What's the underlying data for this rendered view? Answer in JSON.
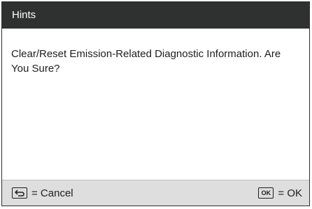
{
  "dialog": {
    "title": "Hints",
    "message": "Clear/Reset Emission-Related Diagnostic Information. Are You Sure?"
  },
  "footer": {
    "cancel_key_icon": "back-arrow-icon",
    "cancel_label": "= Cancel",
    "ok_key_text": "OK",
    "ok_label": "= OK"
  },
  "colors": {
    "titlebar_bg": "#2f3030",
    "footer_bg": "#dedede",
    "text": "#1d1d1d"
  }
}
